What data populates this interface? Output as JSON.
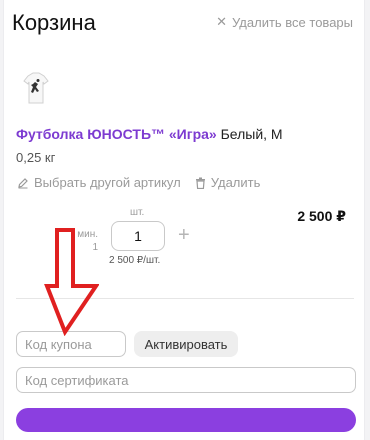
{
  "cart": {
    "title": "Корзина",
    "clear_all_label": "Удалить все товары"
  },
  "product": {
    "name": "Футболка ЮНОСТЬ™ «Игра»",
    "variant": " Белый, M",
    "weight": "0,25 кг",
    "choose_other_label": "Выбрать другой артикул",
    "delete_label": "Удалить",
    "price": "2 500 ₽",
    "min_label": "мин.",
    "min_value": "1",
    "unit_label": "шт.",
    "quantity": "1",
    "unit_price": "2 500 ₽/шт."
  },
  "coupon": {
    "placeholder": "Код купона",
    "activate_label": "Активировать"
  },
  "certificate": {
    "placeholder": "Код сертификата"
  },
  "colors": {
    "accent": "#8b3fe0",
    "link": "#7d3bd1",
    "annotation": "#e02020"
  },
  "icons": {
    "clear_all": "close-icon",
    "choose_other": "pencil-icon",
    "delete": "trash-icon",
    "quantity_add": "plus-icon"
  }
}
